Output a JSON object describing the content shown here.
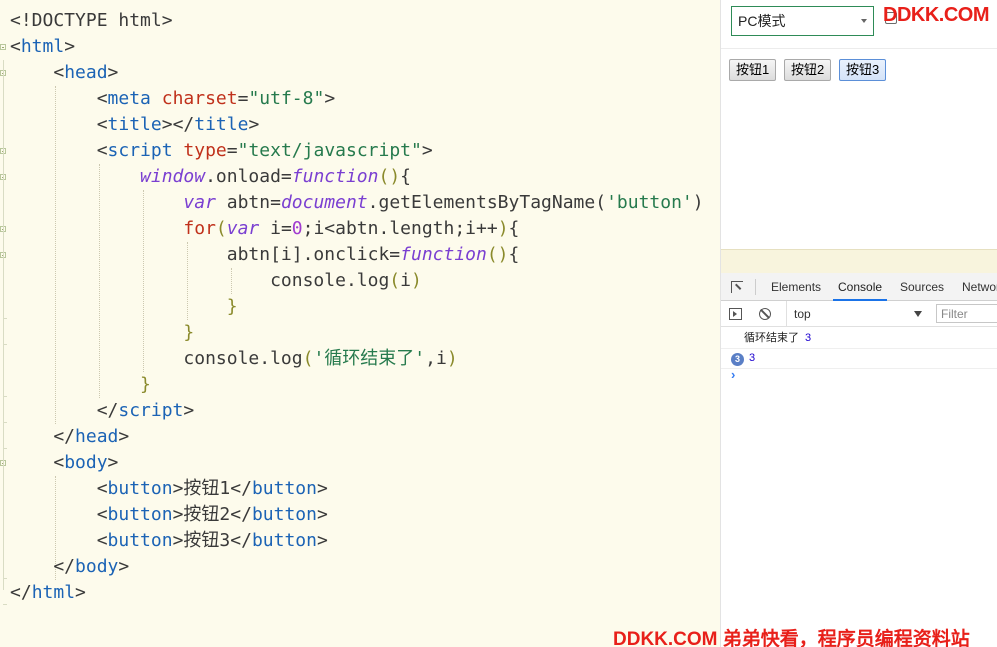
{
  "editor": {
    "lines": [
      [
        {
          "c": "t-punc",
          "t": "<!DOCTYPE html>"
        }
      ],
      [
        {
          "c": "t-punc",
          "t": "<"
        },
        {
          "c": "t-tag",
          "t": "html"
        },
        {
          "c": "t-punc",
          "t": ">"
        }
      ],
      [
        {
          "c": "t-punc",
          "t": "    <"
        },
        {
          "c": "t-tag",
          "t": "head"
        },
        {
          "c": "t-punc",
          "t": ">"
        }
      ],
      [
        {
          "c": "t-punc",
          "t": "        <"
        },
        {
          "c": "t-tag",
          "t": "meta"
        },
        {
          "c": "t-plain",
          "t": " "
        },
        {
          "c": "t-attr",
          "t": "charset"
        },
        {
          "c": "t-punc",
          "t": "="
        },
        {
          "c": "t-str",
          "t": "\"utf-8\""
        },
        {
          "c": "t-punc",
          "t": ">"
        }
      ],
      [
        {
          "c": "t-punc",
          "t": "        <"
        },
        {
          "c": "t-tag",
          "t": "title"
        },
        {
          "c": "t-punc",
          "t": "></"
        },
        {
          "c": "t-tag",
          "t": "title"
        },
        {
          "c": "t-punc",
          "t": ">"
        }
      ],
      [
        {
          "c": "t-punc",
          "t": "        <"
        },
        {
          "c": "t-tag",
          "t": "script"
        },
        {
          "c": "t-plain",
          "t": " "
        },
        {
          "c": "t-attr",
          "t": "type"
        },
        {
          "c": "t-punc",
          "t": "="
        },
        {
          "c": "t-str",
          "t": "\"text/javascript\""
        },
        {
          "c": "t-punc",
          "t": ">"
        }
      ],
      [
        {
          "c": "t-plain",
          "t": "            "
        },
        {
          "c": "t-kw",
          "t": "window"
        },
        {
          "c": "t-plain",
          "t": ".onload="
        },
        {
          "c": "t-kw",
          "t": "function"
        },
        {
          "c": "t-paren",
          "t": "()"
        },
        {
          "c": "t-plain",
          "t": "{"
        }
      ],
      [
        {
          "c": "t-plain",
          "t": "                "
        },
        {
          "c": "t-kw",
          "t": "var"
        },
        {
          "c": "t-plain",
          "t": " abtn="
        },
        {
          "c": "t-kw",
          "t": "document"
        },
        {
          "c": "t-plain",
          "t": ".getElementsByTagName("
        },
        {
          "c": "t-str",
          "t": "'button'"
        },
        {
          "c": "t-plain",
          "t": ")"
        }
      ],
      [
        {
          "c": "t-plain",
          "t": "                "
        },
        {
          "c": "t-attr",
          "t": "for"
        },
        {
          "c": "t-paren",
          "t": "("
        },
        {
          "c": "t-kw",
          "t": "var"
        },
        {
          "c": "t-plain",
          "t": " i="
        },
        {
          "c": "t-num",
          "t": "0"
        },
        {
          "c": "t-plain",
          "t": ";i<abtn.length;i++"
        },
        {
          "c": "t-paren",
          "t": ")"
        },
        {
          "c": "t-plain",
          "t": "{"
        }
      ],
      [
        {
          "c": "t-plain",
          "t": "                    abtn[i].onclick="
        },
        {
          "c": "t-kw",
          "t": "function"
        },
        {
          "c": "t-paren",
          "t": "()"
        },
        {
          "c": "t-plain",
          "t": "{"
        }
      ],
      [
        {
          "c": "t-plain",
          "t": "                        console.log"
        },
        {
          "c": "t-paren",
          "t": "("
        },
        {
          "c": "t-plain",
          "t": "i"
        },
        {
          "c": "t-paren",
          "t": ")"
        }
      ],
      [
        {
          "c": "t-plain",
          "t": "                    "
        },
        {
          "c": "t-paren",
          "t": "}"
        }
      ],
      [
        {
          "c": "t-plain",
          "t": "                "
        },
        {
          "c": "t-paren",
          "t": "}"
        }
      ],
      [
        {
          "c": "t-plain",
          "t": "                console.log"
        },
        {
          "c": "t-paren",
          "t": "("
        },
        {
          "c": "t-str",
          "t": "'循环结束了'"
        },
        {
          "c": "t-plain",
          "t": ",i"
        },
        {
          "c": "t-paren",
          "t": ")"
        }
      ],
      [
        {
          "c": "t-plain",
          "t": "            "
        },
        {
          "c": "t-paren",
          "t": "}"
        }
      ],
      [
        {
          "c": "t-punc",
          "t": "        </"
        },
        {
          "c": "t-tag",
          "t": "script"
        },
        {
          "c": "t-punc",
          "t": ">"
        }
      ],
      [
        {
          "c": "t-punc",
          "t": "    </"
        },
        {
          "c": "t-tag",
          "t": "head"
        },
        {
          "c": "t-punc",
          "t": ">"
        }
      ],
      [
        {
          "c": "t-punc",
          "t": "    <"
        },
        {
          "c": "t-tag",
          "t": "body"
        },
        {
          "c": "t-punc",
          "t": ">"
        }
      ],
      [
        {
          "c": "t-punc",
          "t": "        <"
        },
        {
          "c": "t-tag",
          "t": "button"
        },
        {
          "c": "t-punc",
          "t": ">"
        },
        {
          "c": "t-plain",
          "t": "按钮1"
        },
        {
          "c": "t-punc",
          "t": "</"
        },
        {
          "c": "t-tag",
          "t": "button"
        },
        {
          "c": "t-punc",
          "t": ">"
        }
      ],
      [
        {
          "c": "t-punc",
          "t": "        <"
        },
        {
          "c": "t-tag",
          "t": "button"
        },
        {
          "c": "t-punc",
          "t": ">"
        },
        {
          "c": "t-plain",
          "t": "按钮2"
        },
        {
          "c": "t-punc",
          "t": "</"
        },
        {
          "c": "t-tag",
          "t": "button"
        },
        {
          "c": "t-punc",
          "t": ">"
        }
      ],
      [
        {
          "c": "t-punc",
          "t": "        <"
        },
        {
          "c": "t-tag",
          "t": "button"
        },
        {
          "c": "t-punc",
          "t": ">"
        },
        {
          "c": "t-plain",
          "t": "按钮3"
        },
        {
          "c": "t-punc",
          "t": "</"
        },
        {
          "c": "t-tag",
          "t": "button"
        },
        {
          "c": "t-punc",
          "t": ">"
        }
      ],
      [
        {
          "c": "t-punc",
          "t": "    </"
        },
        {
          "c": "t-tag",
          "t": "body"
        },
        {
          "c": "t-punc",
          "t": ">"
        }
      ],
      [
        {
          "c": "t-punc",
          "t": "</"
        },
        {
          "c": "t-tag",
          "t": "html"
        },
        {
          "c": "t-punc",
          "t": ">"
        }
      ]
    ]
  },
  "preview": {
    "mode_select": "PC模式",
    "watermark_top": "DDKK.COM",
    "buttons": [
      "按钮1",
      "按钮2",
      "按钮3"
    ],
    "focused_button": "按钮3"
  },
  "devtools": {
    "tabs": [
      "Elements",
      "Console",
      "Sources",
      "Network"
    ],
    "active_tab": "Console",
    "context": "top",
    "filter_placeholder": "Filter",
    "messages": [
      {
        "text": "循环结束了",
        "value": "3"
      }
    ],
    "repeat": {
      "count": "3",
      "value": "3"
    },
    "prompt": "›"
  },
  "watermark_bottom": "DDKK.COM 弟弟快看，程序员编程资料站",
  "colors": {
    "editor_bg": "#fdfbec",
    "tag": "#1b63b5",
    "attr": "#c0311b",
    "string": "#267a4d",
    "keyword": "#7a3fd1",
    "watermark": "#e8201a"
  }
}
